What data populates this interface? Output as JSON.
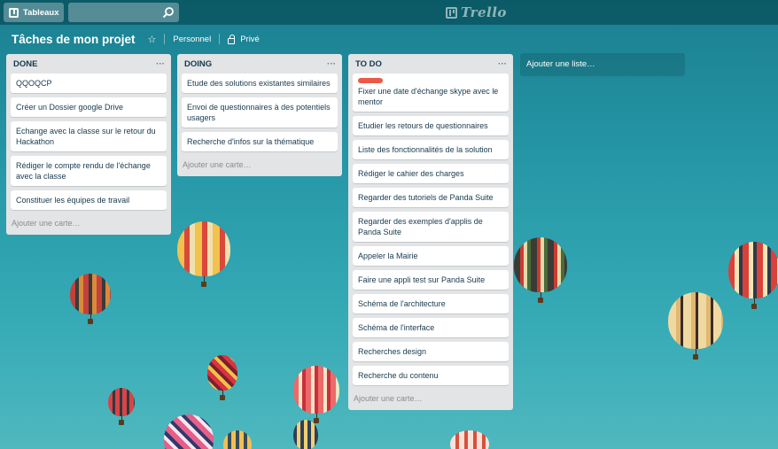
{
  "header": {
    "boards_label": "Tableaux",
    "search_value": "",
    "logo_text": "Trello"
  },
  "board": {
    "title": "Tâches de mon projet",
    "team": "Personnel",
    "visibility": "Privé"
  },
  "lists": [
    {
      "title": "DONE",
      "menu": "···",
      "cards": [
        "QQOQCP",
        "Créer un Dossier google Drive",
        "Echange avec la classe sur le retour du Hackathon",
        "Rédiger le compte rendu de l'échange avec la classe",
        "Constituer les équipes de travail"
      ],
      "add_card": "Ajouter une carte…"
    },
    {
      "title": "DOING",
      "menu": "···",
      "cards": [
        "Etude des solutions existantes similaires",
        "Envoi de questionnaires à des potentiels usagers",
        "Recherche d'infos sur la thématique"
      ],
      "add_card": "Ajouter une carte…"
    },
    {
      "title": "TO DO",
      "menu": "···",
      "cards": [
        "Fixer une date d'échange skype avec le mentor",
        "Etudier les retours de questionnaires",
        "Liste des fonctionnalités de la solution",
        "Rédiger le cahier des charges",
        "Regarder des tutoriels de Panda Suite",
        "Regarder des exemples d'applis de Panda Suite",
        "Appeler la Mairie",
        "Faire une appli test sur Panda Suite",
        "Schéma de l'architecture",
        "Schéma de l'interface",
        "Recherches design",
        "Recherche du contenu"
      ],
      "add_card": "Ajouter une carte…"
    }
  ],
  "add_list": "Ajouter une liste…",
  "colors": {
    "card_label": "#eb5a46",
    "list_bg": "#e2e4e6",
    "sky": "#2596a6"
  }
}
